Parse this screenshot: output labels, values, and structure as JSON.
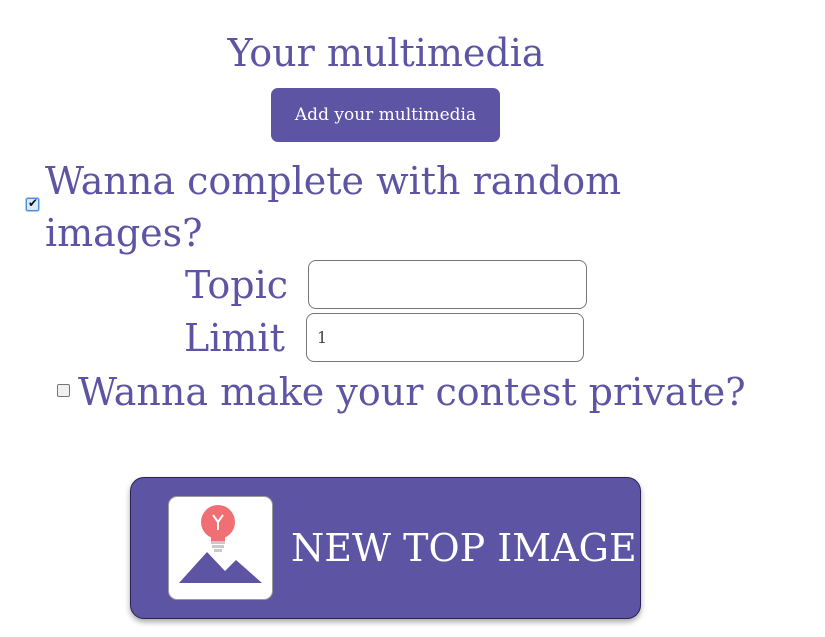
{
  "multimedia": {
    "title": "Your multimedia",
    "add_button_label": "Add your multimedia"
  },
  "random_images": {
    "checked": true,
    "label": "Wanna complete with random images?",
    "topic_label": "Topic",
    "topic_value": "",
    "limit_label": "Limit",
    "limit_value": "1"
  },
  "private_contest": {
    "checked": false,
    "label": "Wanna make your contest private?"
  },
  "new_top_image": {
    "label": "NEW TOP IMAGE",
    "icon": "image-with-lightbulb-icon"
  },
  "colors": {
    "accent": "#5e54a4",
    "button_text": "#ffffff",
    "lightbulb": "#ef6f73"
  }
}
